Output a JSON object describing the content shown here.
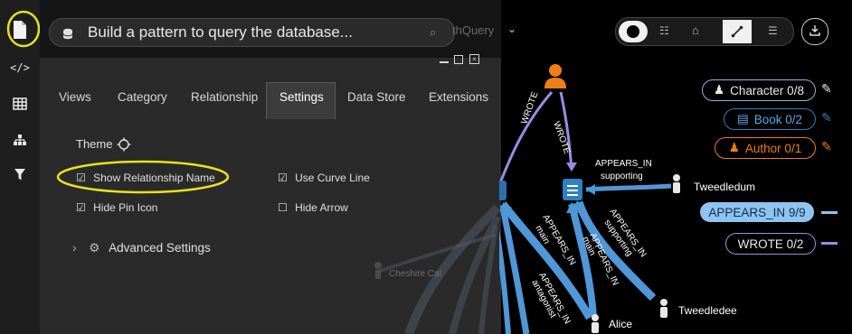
{
  "search": {
    "placeholder": "Build a pattern to query the database...",
    "query_hint": "thQuery"
  },
  "tabs": [
    "Views",
    "Category",
    "Relationship",
    "Settings",
    "Data Store",
    "Extensions"
  ],
  "settings": {
    "theme_label": "Theme",
    "show_relationship_name": "Show Relationship Name",
    "use_curve_line": "Use Curve Line",
    "hide_pin_icon": "Hide Pin Icon",
    "hide_arrow": "Hide Arrow",
    "advanced": "Advanced Settings"
  },
  "legend": {
    "character": "Character 0/8",
    "book": "Book 0/2",
    "author": "Author 0/1",
    "appears_in": "APPEARS_IN 9/9",
    "wrote": "WROTE 0/2"
  },
  "graph": {
    "nodes": {
      "tweedledum": "Tweedledum",
      "tweedledee": "Tweedledee",
      "alice": "Alice",
      "cheshire": "Cheshire Cat"
    },
    "edges": {
      "wrote": "WROTE",
      "appears_in": "APPEARS_IN",
      "supporting": "supporting",
      "main": "main",
      "antagonist": "antagonist"
    }
  },
  "colors": {
    "accent": "#2f7fc1",
    "author": "#f07c1a",
    "appears": "#5aa6e8",
    "wrote": "#9b8ce0"
  }
}
